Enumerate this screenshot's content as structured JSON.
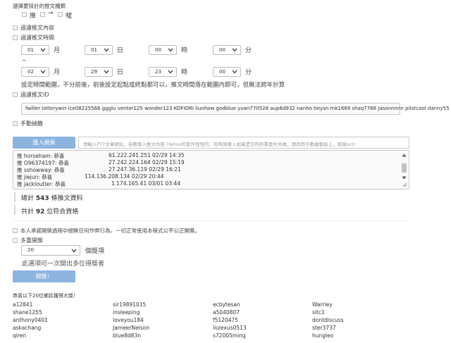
{
  "options": {
    "select_type_label": "選擇要採計的推文種類",
    "types": [
      {
        "symbol": "推",
        "checked": true
      },
      {
        "symbol": "→",
        "checked": false
      },
      {
        "symbol": "噓",
        "checked": false
      }
    ],
    "filter_content_label": "過濾推文內容",
    "filter_time_label": "過濾推文時間"
  },
  "time": {
    "start": {
      "month": "01",
      "day": "01",
      "hour": "00",
      "minute": "00"
    },
    "end": {
      "month": "02",
      "day": "29",
      "hour": "23",
      "minute": "00"
    },
    "unit_month": "月",
    "unit_day": "日",
    "unit_hour": "時",
    "unit_minute": "分",
    "separator": "~",
    "hint": "設定時間範圍，不分前後，前後設定起點或終點都可以，推文時間落在範圍內即可，但無法跨年計算"
  },
  "filter_id": {
    "label": "過濾推文ID",
    "value": "fwiller lotterywin ice08225566 ggglu venter125  wonder123 KOFIORI liunhow godblue yuan770528  aup6d932 nanho tieysn mk1689 shaq7766 Jasonnnnn pilotcool danny55"
  },
  "manual_label": "手動抽籤",
  "import": {
    "button": "匯入網頁",
    "placeholder": "請輸入PTT文章網址，自動匯入推文內容 (Yahoo的套件怪怪的，有時候匯入如果是空的則重套件失敗，請改用手動複製貼上，感謝orz)"
  },
  "log": [
    {
      "user": "推 horseham: 恭喜",
      "info": "61.222.241.251 02/29 14:35"
    },
    {
      "user": "推 O96374197: 恭喜",
      "info": "27.242.224.164 02/29 15:19"
    },
    {
      "user": "推 sshowway: 恭喜",
      "info": "27.247.36.119 02/29 16:21"
    },
    {
      "user": "推 jiejun: 恭喜",
      "info": "114.136.208.134 02/29 20:44"
    },
    {
      "user": "推 jackloutler: 恭喜",
      "info": "1.174.165.41 03/01 03:44"
    }
  ],
  "stats": {
    "total_prefix": "總計",
    "total_count": "543",
    "total_suffix": "條推文資料",
    "valid_prefix": "共計",
    "valid_count": "92",
    "valid_suffix": "位符合資格"
  },
  "draw": {
    "agree_label": "本人承諾開獎過程中絕無任何作弊行為，一切正常使用本程式公平公正開獎。",
    "multi_label": "多重開獎",
    "count_value": "20",
    "count_unit": "個獎項",
    "hint": "此選項可一次開出多位得獎者",
    "button": "開獎！"
  },
  "result": {
    "heading": "恭喜以下20位鄉民獲得大獎！",
    "columns": [
      [
        "a12841",
        "shane1255",
        "anthony0401",
        "askachang",
        "qiren"
      ],
      [
        "sir19891015",
        "insleeping",
        "loveyou184",
        "JameerNelson",
        "blue8d83n"
      ],
      [
        "ecbytesan",
        "a5040807",
        "f5120475",
        "liulexus0513",
        "s72005ming"
      ],
      [
        "Warriey",
        "sitc1",
        "dontdiscuss",
        "ster3737",
        "hungleo"
      ]
    ]
  }
}
